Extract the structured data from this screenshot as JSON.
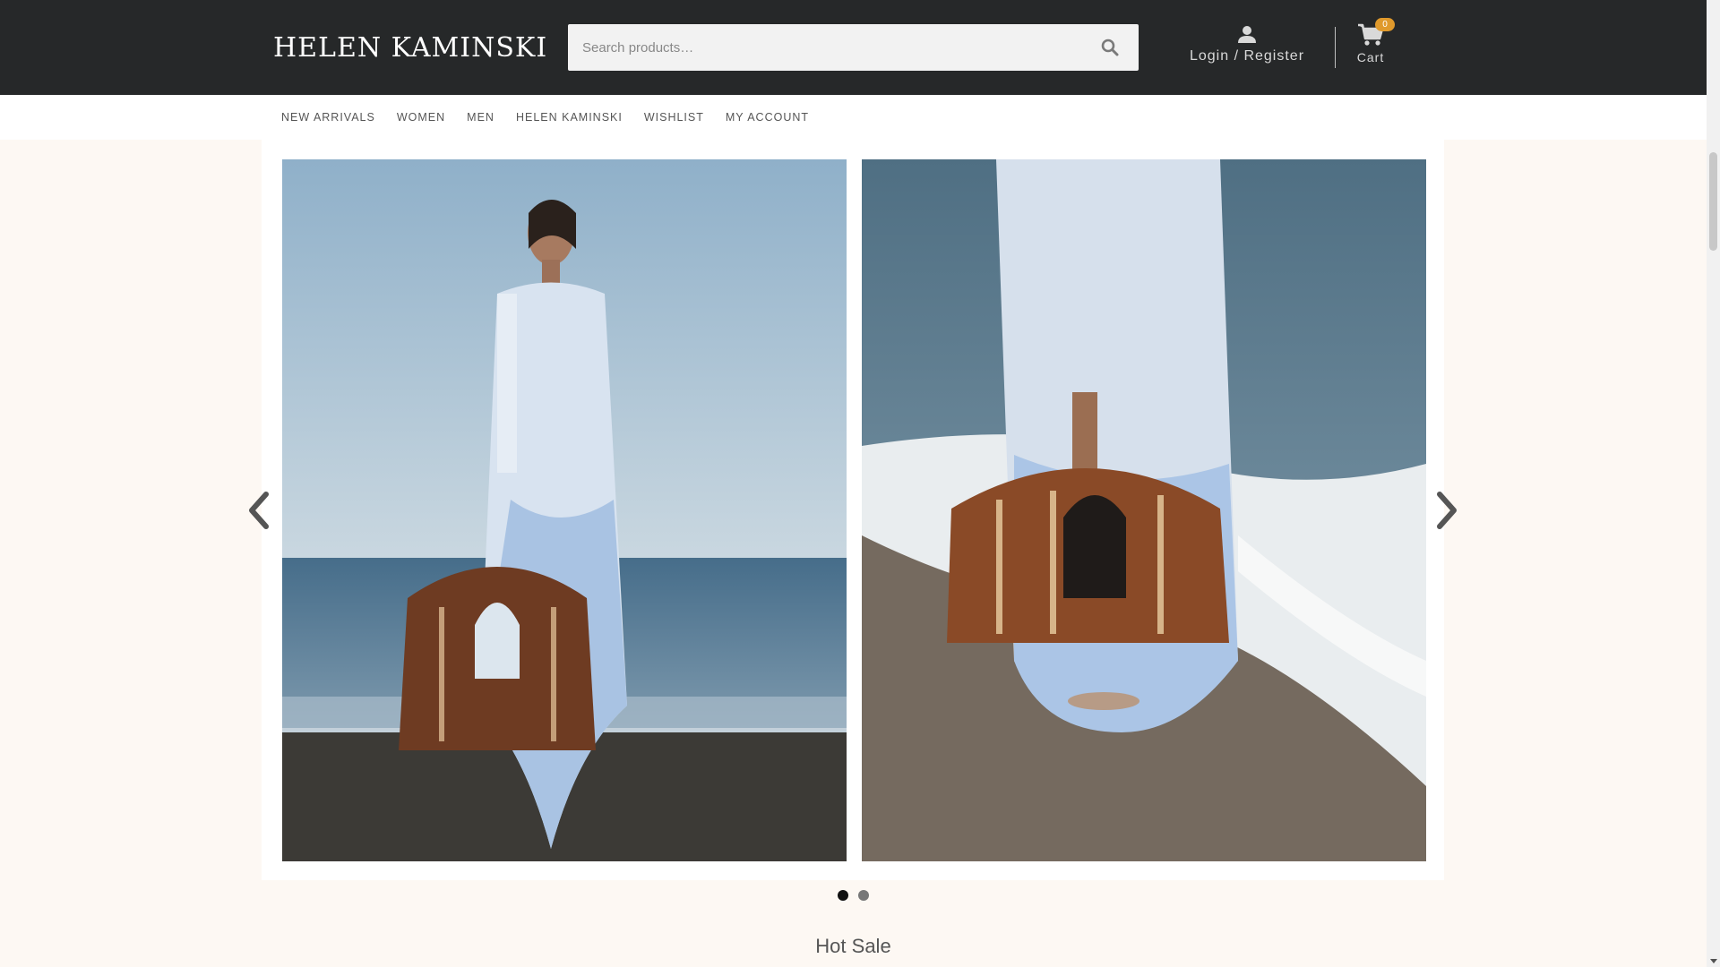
{
  "header": {
    "logo": "HELEN KAMINSKI",
    "search_placeholder": "Search products…",
    "login_label": "Login / Register",
    "cart_label": "Cart",
    "cart_count": "0"
  },
  "nav": {
    "items": [
      "NEW ARRIVALS",
      "WOMEN",
      "MEN",
      "HELEN KAMINSKI",
      "WISHLIST",
      "MY ACCOUNT"
    ]
  },
  "slider": {
    "dot_count": 2,
    "active_dot": 1
  },
  "sections": {
    "hot_sale_title": "Hot Sale"
  },
  "colors": {
    "header_bg": "#262829",
    "page_bg": "#fdf8f3",
    "badge": "#e09a2c"
  }
}
